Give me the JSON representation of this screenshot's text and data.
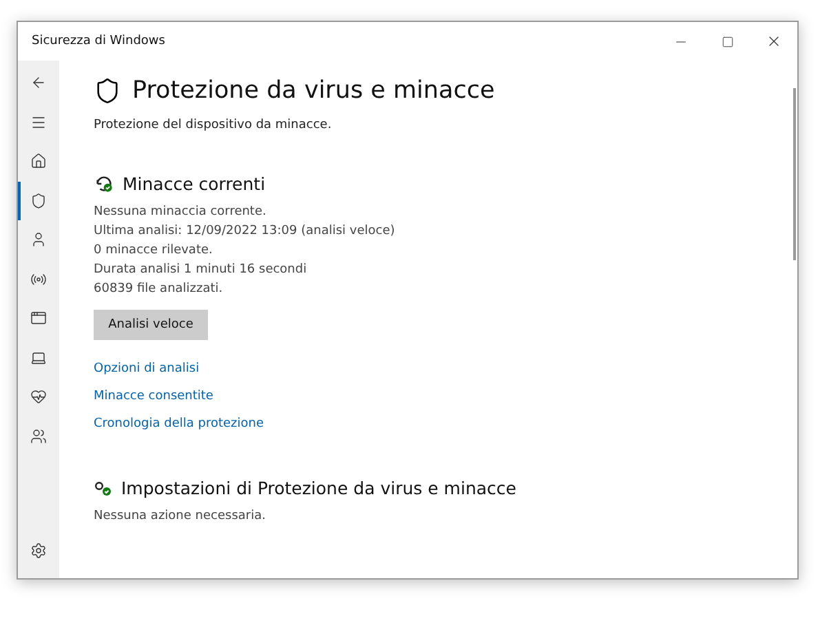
{
  "window": {
    "title": "Sicurezza di Windows"
  },
  "nav": [
    {
      "kind": "back",
      "selected": false
    },
    {
      "kind": "menu",
      "selected": false
    },
    {
      "kind": "home",
      "selected": false
    },
    {
      "kind": "shield",
      "selected": true
    },
    {
      "kind": "user",
      "selected": false
    },
    {
      "kind": "network",
      "selected": false
    },
    {
      "kind": "app",
      "selected": false
    },
    {
      "kind": "device",
      "selected": false
    },
    {
      "kind": "health",
      "selected": false
    },
    {
      "kind": "family",
      "selected": false
    }
  ],
  "page": {
    "title": "Protezione da virus e minacce",
    "subtitle": "Protezione del dispositivo da minacce."
  },
  "threats": {
    "title": "Minacce correnti",
    "lines": [
      "Nessuna minaccia corrente.",
      "Ultima analisi: 12/09/2022 13:09 (analisi veloce)",
      "0 minacce rilevate.",
      "Durata analisi 1 minuti 16 secondi",
      "60839 file analizzati."
    ],
    "button": "Analisi veloce",
    "links": [
      "Opzioni di analisi",
      "Minacce consentite",
      "Cronologia della protezione"
    ]
  },
  "settings_section": {
    "title": "Impostazioni di Protezione da virus e minacce",
    "status": "Nessuna azione necessaria."
  }
}
